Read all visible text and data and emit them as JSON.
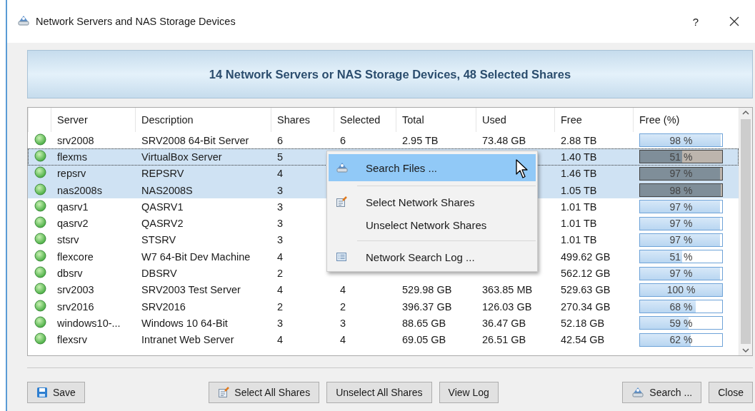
{
  "window": {
    "title": "Network Servers and NAS Storage Devices",
    "help": "?"
  },
  "banner": "14 Network Servers or NAS Storage Devices, 48 Selected Shares",
  "table": {
    "columns": [
      "Server",
      "Description",
      "Shares",
      "Selected",
      "Total",
      "Used",
      "Free",
      "Free (%)"
    ],
    "rows": [
      {
        "server": "srv2008",
        "description": "SRV2008 64-Bit Server",
        "shares": "6",
        "selected_count": "6",
        "total": "2.95 TB",
        "used": "73.48 GB",
        "free": "2.88 TB",
        "free_pct": "98 %",
        "level": 0.98,
        "selected": false,
        "focused": false
      },
      {
        "server": "flexms",
        "description": "VirtualBox Server",
        "shares": "5",
        "free": "1.40 TB",
        "free_pct": "51 %",
        "level": 0.51,
        "selected": true,
        "focused": true
      },
      {
        "server": "repsrv",
        "description": "REPSRV",
        "shares": "4",
        "free": "1.46 TB",
        "free_pct": "97 %",
        "level": 0.97,
        "selected": true,
        "focused": false
      },
      {
        "server": "nas2008s",
        "description": "NAS2008S",
        "shares": "3",
        "free": "1.05 TB",
        "free_pct": "98 %",
        "level": 0.98,
        "selected": true,
        "focused": false
      },
      {
        "server": "qasrv1",
        "description": "QASRV1",
        "shares": "3",
        "free": "1.01 TB",
        "free_pct": "97 %",
        "level": 0.97,
        "selected": false,
        "focused": false
      },
      {
        "server": "qasrv2",
        "description": "QASRV2",
        "shares": "3",
        "free": "1.01 TB",
        "free_pct": "97 %",
        "level": 0.97,
        "selected": false,
        "focused": false
      },
      {
        "server": "stsrv",
        "description": "STSRV",
        "shares": "3",
        "free": "1.01 TB",
        "free_pct": "97 %",
        "level": 0.97,
        "selected": false,
        "focused": false
      },
      {
        "server": "flexcore",
        "description": "W7 64-Bit Dev Machine",
        "shares": "4",
        "free": "499.62 GB",
        "free_pct": "51 %",
        "level": 0.51,
        "selected": false,
        "focused": false
      },
      {
        "server": "dbsrv",
        "description": "DBSRV",
        "shares": "2",
        "free": "562.12 GB",
        "free_pct": "97 %",
        "level": 0.97,
        "selected": false,
        "focused": false
      },
      {
        "server": "srv2003",
        "description": "SRV2003 Test Server",
        "shares": "4",
        "selected_count": "4",
        "total": "529.98 GB",
        "used": "363.85 MB",
        "free": "529.63 GB",
        "free_pct": "100 %",
        "level": 1,
        "selected": false,
        "focused": false
      },
      {
        "server": "srv2016",
        "description": "SRV2016",
        "shares": "2",
        "selected_count": "2",
        "total": "396.37 GB",
        "used": "126.03 GB",
        "free": "270.34 GB",
        "free_pct": "68 %",
        "level": 0.68,
        "selected": false,
        "focused": false
      },
      {
        "server": "windows10-...",
        "description": "Windows 10 64-Bit",
        "shares": "3",
        "selected_count": "3",
        "total": "88.65 GB",
        "used": "36.47 GB",
        "free": "52.18 GB",
        "free_pct": "59 %",
        "level": 0.59,
        "selected": false,
        "focused": false
      },
      {
        "server": "flexsrv",
        "description": "Intranet Web Server",
        "shares": "4",
        "selected_count": "4",
        "total": "69.05 GB",
        "used": "26.51 GB",
        "free": "42.54 GB",
        "free_pct": "62 %",
        "level": 0.62,
        "selected": false,
        "focused": false
      }
    ]
  },
  "context_menu": [
    {
      "kind": "search",
      "label": "Search Files ...",
      "selected": true
    },
    {
      "kind": "separator"
    },
    {
      "kind": "select",
      "label": "Select Network Shares",
      "selected": false
    },
    {
      "kind": "plain",
      "label": "Unselect Network Shares",
      "selected": false
    },
    {
      "kind": "separator"
    },
    {
      "kind": "log",
      "label": "Network Search Log ...",
      "selected": false
    }
  ],
  "footer": {
    "left": [
      {
        "kind": "save",
        "label": "Save"
      }
    ],
    "center": [
      {
        "kind": "select",
        "label": "Select All Shares"
      },
      {
        "kind": "plain",
        "label": "Unselect All Shares"
      },
      {
        "kind": "plain",
        "label": "View Log"
      }
    ],
    "right": [
      {
        "kind": "search",
        "label": "Search ..."
      },
      {
        "kind": "plain",
        "label": "Close"
      }
    ]
  }
}
